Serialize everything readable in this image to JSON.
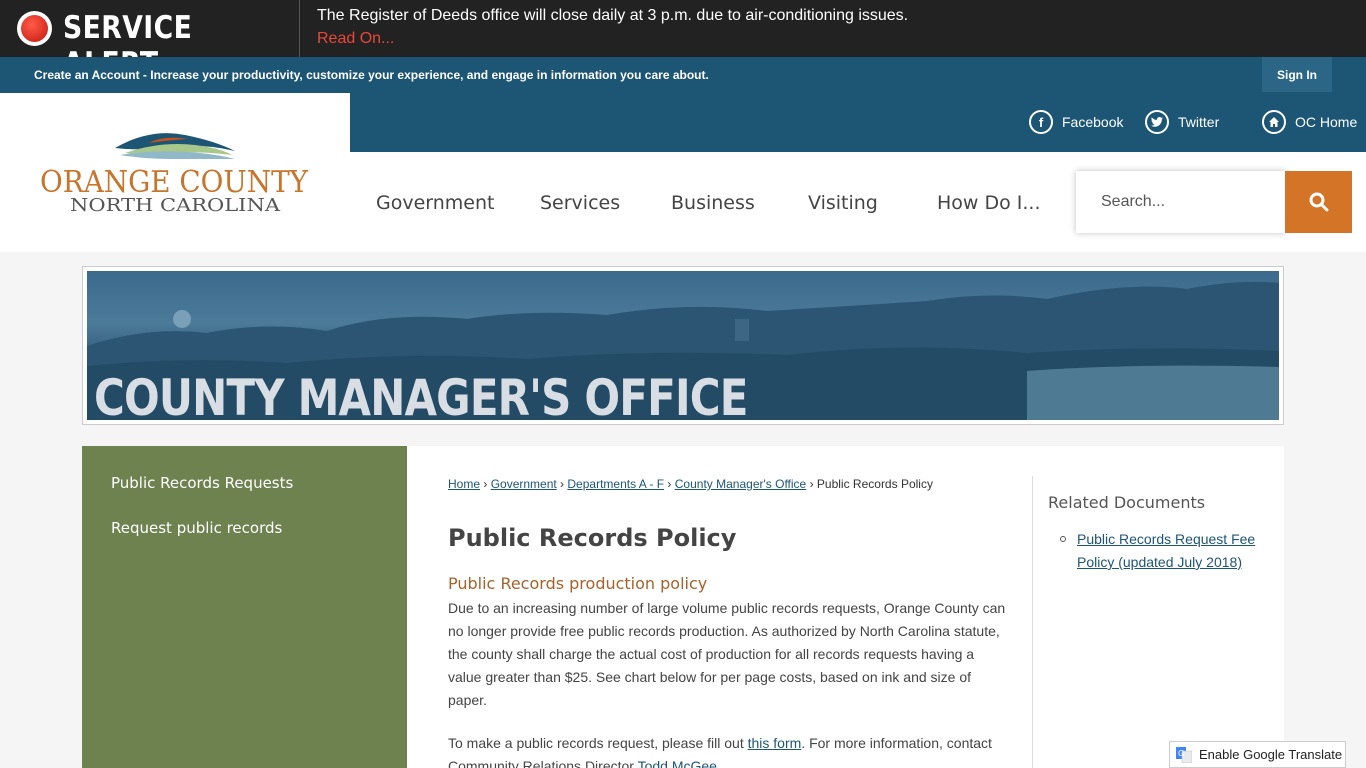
{
  "alert": {
    "title": "SERVICE ALERT",
    "message": "The Register of Deeds office will close daily at 3 p.m. due to air-conditioning issues.",
    "link": "Read On..."
  },
  "account": {
    "text": "Create an Account - Increase your productivity, customize your experience, and engage in information you care about.",
    "signin": "Sign In"
  },
  "logo": {
    "line1": "ORANGE COUNTY",
    "line2": "NORTH CAROLINA"
  },
  "social": [
    {
      "label": "Facebook",
      "icon": "facebook-icon"
    },
    {
      "label": "Twitter",
      "icon": "twitter-icon"
    },
    {
      "label": "OC Home",
      "icon": "home-icon"
    }
  ],
  "nav": [
    "Government",
    "Services",
    "Business",
    "Visiting",
    "How Do I..."
  ],
  "search": {
    "placeholder": "Search..."
  },
  "banner": {
    "title": "COUNTY MANAGER'S OFFICE"
  },
  "sidebar": [
    "Public Records Requests",
    "Request public records"
  ],
  "breadcrumb": [
    "Home",
    "Government",
    "Departments A - F",
    "County Manager's Office",
    "Public Records Policy"
  ],
  "page": {
    "title": "Public Records Policy",
    "subhead": "Public Records production policy",
    "para1": "Due to an increasing number of large volume public records requests, Orange County can no longer provide free public records production. As authorized by North Carolina statute, the county shall charge the actual cost of production for all records requests having a value greater than $25. See chart below for per page costs, based on ink and size of paper.",
    "para2_pre": "To make a public records request, please fill out ",
    "para2_link": "this form",
    "para2_mid": ". For more information, contact Community Relations Director ",
    "para2_link2": "Todd McGee"
  },
  "related": {
    "title": "Related Documents",
    "link": "Public Records Request Fee Policy (updated July 2018)"
  },
  "translate": {
    "label": "Enable Google Translate"
  },
  "colors": {
    "navy": "#1d5575",
    "orange": "#d47427",
    "olive": "#6e8250",
    "alert_red": "#e8473a"
  }
}
